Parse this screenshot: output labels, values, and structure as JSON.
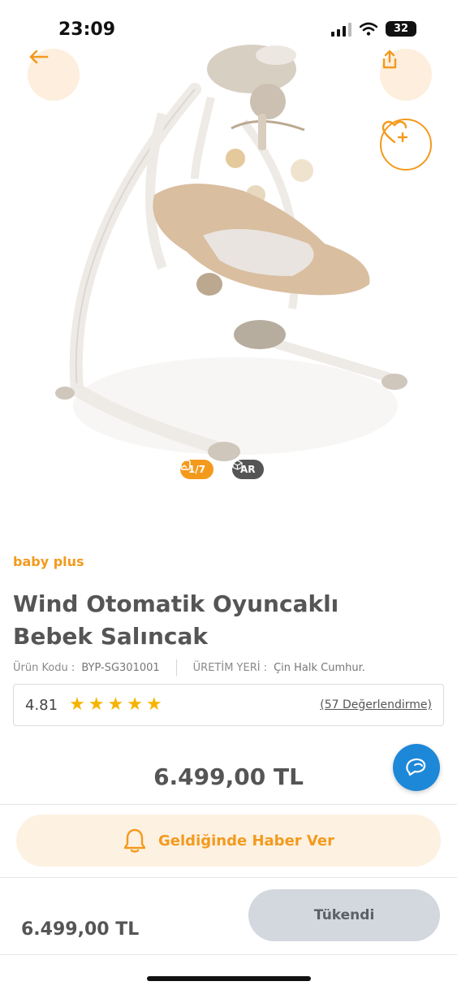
{
  "status_bar": {
    "time": "23:09",
    "battery": "32"
  },
  "hero": {
    "image_counter": "1/7",
    "ar_label": "AR",
    "icons": {
      "back": "arrow-left-icon",
      "share": "share-icon",
      "favorite": "heart-plus-icon",
      "gallery": "image-icon",
      "ar": "cube-icon"
    }
  },
  "product": {
    "brand": "baby plus",
    "title_line1": "Wind Otomatik Oyuncaklı",
    "title_line2": "Bebek Salıncak",
    "code_label": "Ürün Kodu :",
    "code_value": "BYP-SG301001",
    "origin_label": "ÜRETİM YERİ :",
    "origin_value": "Çin Halk Cumhur.",
    "rating": "4.81",
    "stars": 5,
    "reviews_label": "(57 Değerlendirme)",
    "price": "6.499,00 TL"
  },
  "actions": {
    "notify_label": "Geldiğinde Haber Ver",
    "bottom_price": "6.499,00 TL",
    "soldout_label": "Tükendi"
  },
  "colors": {
    "accent": "#f39a1d",
    "chat": "#1e88d8",
    "star": "#f5b400"
  }
}
